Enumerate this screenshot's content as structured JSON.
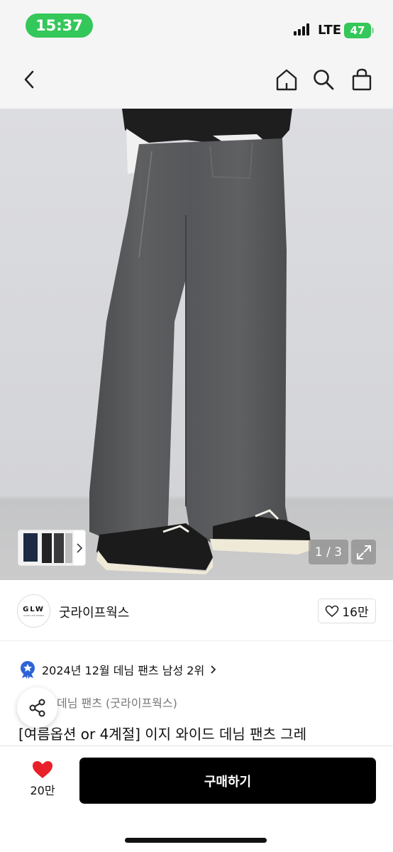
{
  "status_bar": {
    "time": "15:37",
    "network": "LTE",
    "battery": "47"
  },
  "gallery": {
    "page": "1 / 3"
  },
  "brand": {
    "logo_text": "GLW",
    "logo_subtext": "GOOD LIFE WORKS",
    "name": "굿라이프웍스",
    "likes": "16만"
  },
  "ranking": {
    "text": "2024년 12월 데님 팬츠 남성 2위"
  },
  "breadcrumb": {
    "text": "데님 팬츠 (굿라이프웍스)"
  },
  "product": {
    "title": "[여름옵션 or 4계절] 이지 와이드 데님 팬츠 그레"
  },
  "bottom": {
    "wish_count": "20만",
    "buy_label": "구매하기"
  },
  "colors": {
    "accent_green": "#34c759",
    "like_red": "#e8202a",
    "badge_blue": "#2e63d8"
  }
}
